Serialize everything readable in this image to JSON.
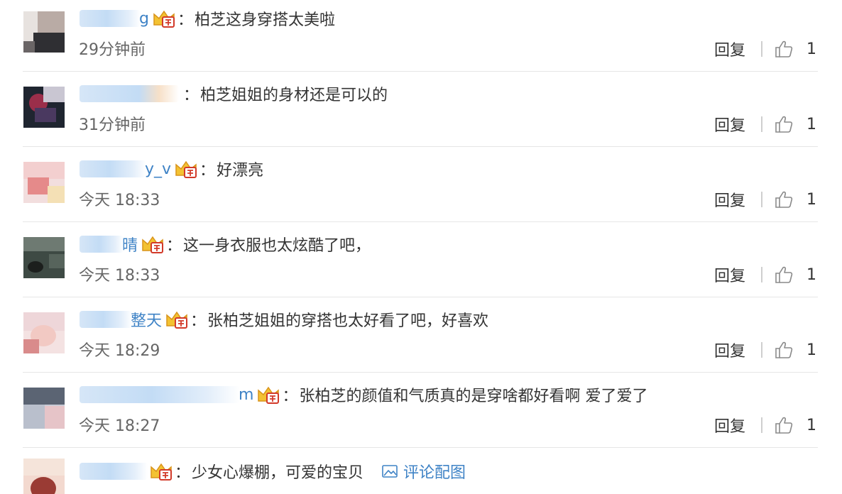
{
  "labels": {
    "reply": "回复",
    "colon": "："
  },
  "icons": {
    "crown": "vip-crown-icon",
    "like": "thumbs-up-icon",
    "image": "image-icon"
  },
  "colors": {
    "username": "#3f83c6",
    "text": "#333333",
    "time": "#666666",
    "divider": "#e6e6e6"
  },
  "comments": [
    {
      "username_tail": "g",
      "text": "柏芝这身穿搭太美啦",
      "time": "29分钟前",
      "likes": "1"
    },
    {
      "username_tail": "",
      "text": "柏芝姐姐的身材还是可以的",
      "time": "31分钟前",
      "likes": "1"
    },
    {
      "username_tail": "y_v",
      "text": "好漂亮",
      "time": "今天 18:33",
      "likes": "1"
    },
    {
      "username_tail": "晴",
      "text": "这一身衣服也太炫酷了吧，",
      "time": "今天 18:33",
      "likes": "1"
    },
    {
      "username_tail": "整天",
      "text": "张柏芝姐姐的穿搭也太好看了吧，好喜欢",
      "time": "今天 18:29",
      "likes": "1"
    },
    {
      "username_tail": "m",
      "text": "张柏芝的颜值和气质真的是穿啥都好看啊 爱了爱了",
      "time": "今天 18:27",
      "likes": "1"
    },
    {
      "username_tail": "",
      "text": "少女心爆棚，可爱的宝贝",
      "pic_link": "评论配图"
    }
  ]
}
